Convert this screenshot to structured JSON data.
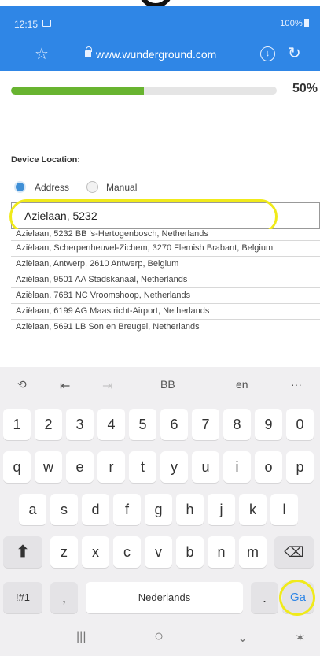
{
  "status_bar": {
    "time": "12:15",
    "right_text": "100%"
  },
  "browser": {
    "url": "www.wunderground.com",
    "star_icon": "star-outline-icon",
    "lock_icon": "lock-icon",
    "download_icon": "download-icon",
    "reload_icon": "reload-icon"
  },
  "progress": {
    "value_percent": 50,
    "label": "50%",
    "fill_color": "#68b430"
  },
  "location": {
    "label": "Device Location:",
    "options": [
      "Address",
      "Manual"
    ],
    "selected": "Address",
    "input_value": "Azielaan, 5232",
    "suggestions": [
      "Azielaan, 5232 BB 's-Hertogenbosch, Netherlands",
      "Aziëlaan, Scherpenheuvel-Zichem, 3270 Flemish Brabant, Belgium",
      "Aziëlaan, Antwerp, 2610 Antwerp, Belgium",
      "Aziëlaan, 9501 AA Stadskanaal, Netherlands",
      "Aziëlaan, 7681 NC Vroomshoop, Netherlands",
      "Aziëlaan, 6199 AG Maastricht-Airport, Netherlands",
      "Aziëlaan, 5691 LB Son en Breugel, Netherlands"
    ]
  },
  "keyboard": {
    "toolbar": {
      "clipboard_icon": "clipboard-icon",
      "tab_back": "⇤",
      "tab_forward": "⇥",
      "bb": "BB",
      "lang": "en",
      "more": "···"
    },
    "row_numbers": [
      "1",
      "2",
      "3",
      "4",
      "5",
      "6",
      "7",
      "8",
      "9",
      "0"
    ],
    "row_q": [
      "q",
      "w",
      "e",
      "r",
      "t",
      "y",
      "u",
      "i",
      "o",
      "p"
    ],
    "row_a": [
      "a",
      "s",
      "d",
      "f",
      "g",
      "h",
      "j",
      "k",
      "l"
    ],
    "row_z": [
      "z",
      "x",
      "c",
      "v",
      "b",
      "n",
      "m"
    ],
    "shift_icon": "shift-arrow-icon",
    "backspace_icon": "backspace-icon",
    "symbols": "!#1",
    "comma": ",",
    "space": "Nederlands",
    "period": ".",
    "go": "Ga",
    "go_color": "#2f86e6"
  },
  "navbar": {
    "recents_icon": "recents-icon",
    "home_icon": "home-icon",
    "back_icon": "back-chevron-icon",
    "accessibility_icon": "accessibility-icon"
  },
  "highlight_color": "#f0ea1a"
}
